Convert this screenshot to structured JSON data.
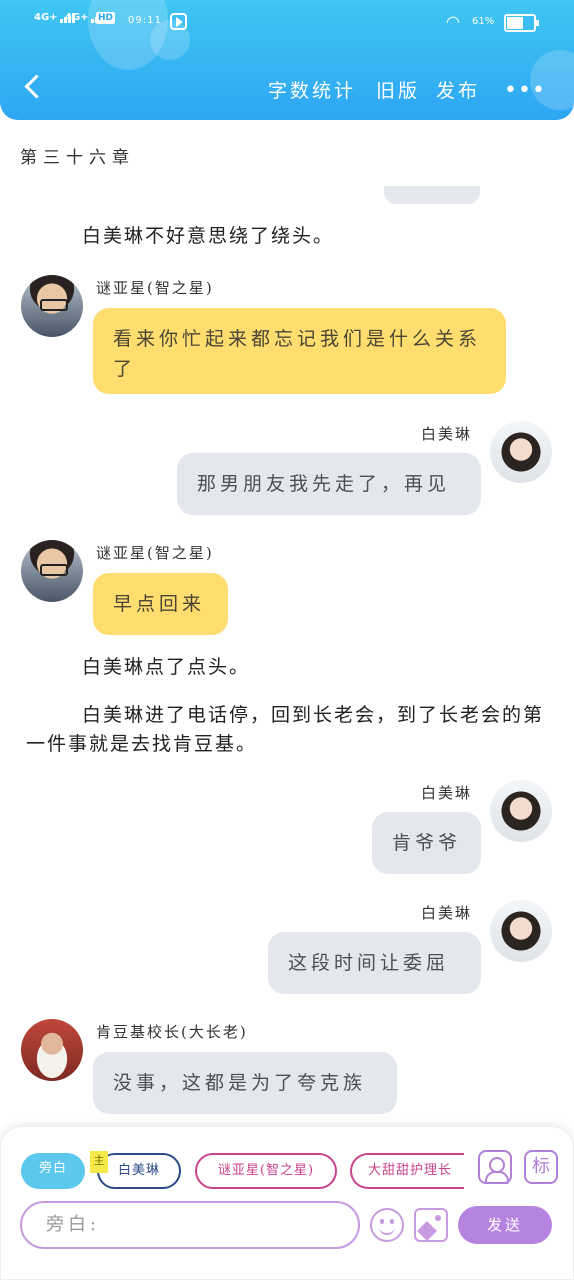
{
  "status_bar": {
    "signal1": "4G+",
    "signal2": "4G+",
    "hd": "HD",
    "time": "09:11",
    "battery_pct": "61%",
    "battery_level": 0.61
  },
  "header": {
    "word_count_label": "字数统计",
    "old_version_label": "旧版",
    "publish_label": "发布",
    "more_label": "•••"
  },
  "chapter_title": "第三十六章",
  "narration": [
    "白美琳不好意思绕了绕头。",
    "白美琳点了点头。",
    "白美琳进了电话停，回到长老会，到了长老会的第一件事就是去找肯豆基。"
  ],
  "messages": [
    {
      "name": "谜亚星(智之星)",
      "text": "看来你忙起来都忘记我们是什么关系了"
    },
    {
      "name": "白美琳",
      "text": "那男朋友我先走了，再见"
    },
    {
      "name": "谜亚星(智之星)",
      "text": "早点回来"
    },
    {
      "name": "白美琳",
      "text": "肯爷爷"
    },
    {
      "name": "白美琳",
      "text": "这段时间让委屈"
    },
    {
      "name": "肯豆基校长(大长老)",
      "text": "没事，这都是为了夸克族"
    }
  ],
  "composer": {
    "chips": [
      "旁白",
      "白美琳",
      "谜亚星(智之星)",
      "大甜甜护理长"
    ],
    "main_tag": "主",
    "mark_label": "标",
    "input_placeholder": "旁白:",
    "send_label": "发送"
  }
}
